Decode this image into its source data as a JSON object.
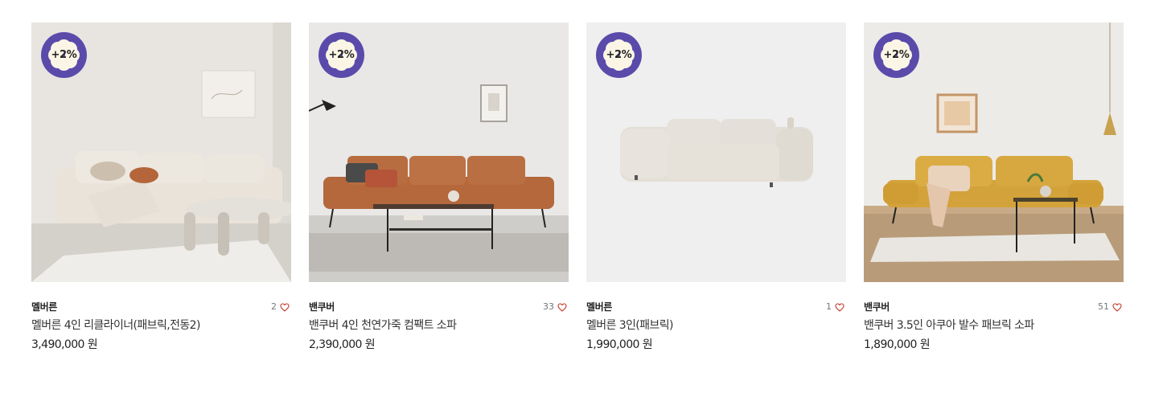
{
  "products": [
    {
      "badge": "+2%",
      "brand": "멜버른",
      "likes": "2",
      "name": "멜버른 4인 리클라이너(패브릭,전동2)",
      "price": "3,490,000 원",
      "image": "beige-recliner-sofa-living-room"
    },
    {
      "badge": "+2%",
      "brand": "밴쿠버",
      "likes": "33",
      "name": "밴쿠버 4인 천연가죽 컴팩트 소파",
      "price": "2,390,000 원",
      "image": "brown-leather-sofa-living-room"
    },
    {
      "badge": "+2%",
      "brand": "멜버른",
      "likes": "1",
      "name": "멜버른 3인(패브릭)",
      "price": "1,990,000 원",
      "image": "cream-fabric-sofa-cutout"
    },
    {
      "badge": "+2%",
      "brand": "밴쿠버",
      "likes": "51",
      "name": "밴쿠버 3.5인 아쿠아 발수 패브릭 소파",
      "price": "1,890,000 원",
      "image": "mustard-fabric-sofa-living-room"
    }
  ],
  "colors": {
    "badge_bg": "#5a4bab",
    "badge_flower": "#fbf5e6",
    "heart": "#c0392b"
  }
}
